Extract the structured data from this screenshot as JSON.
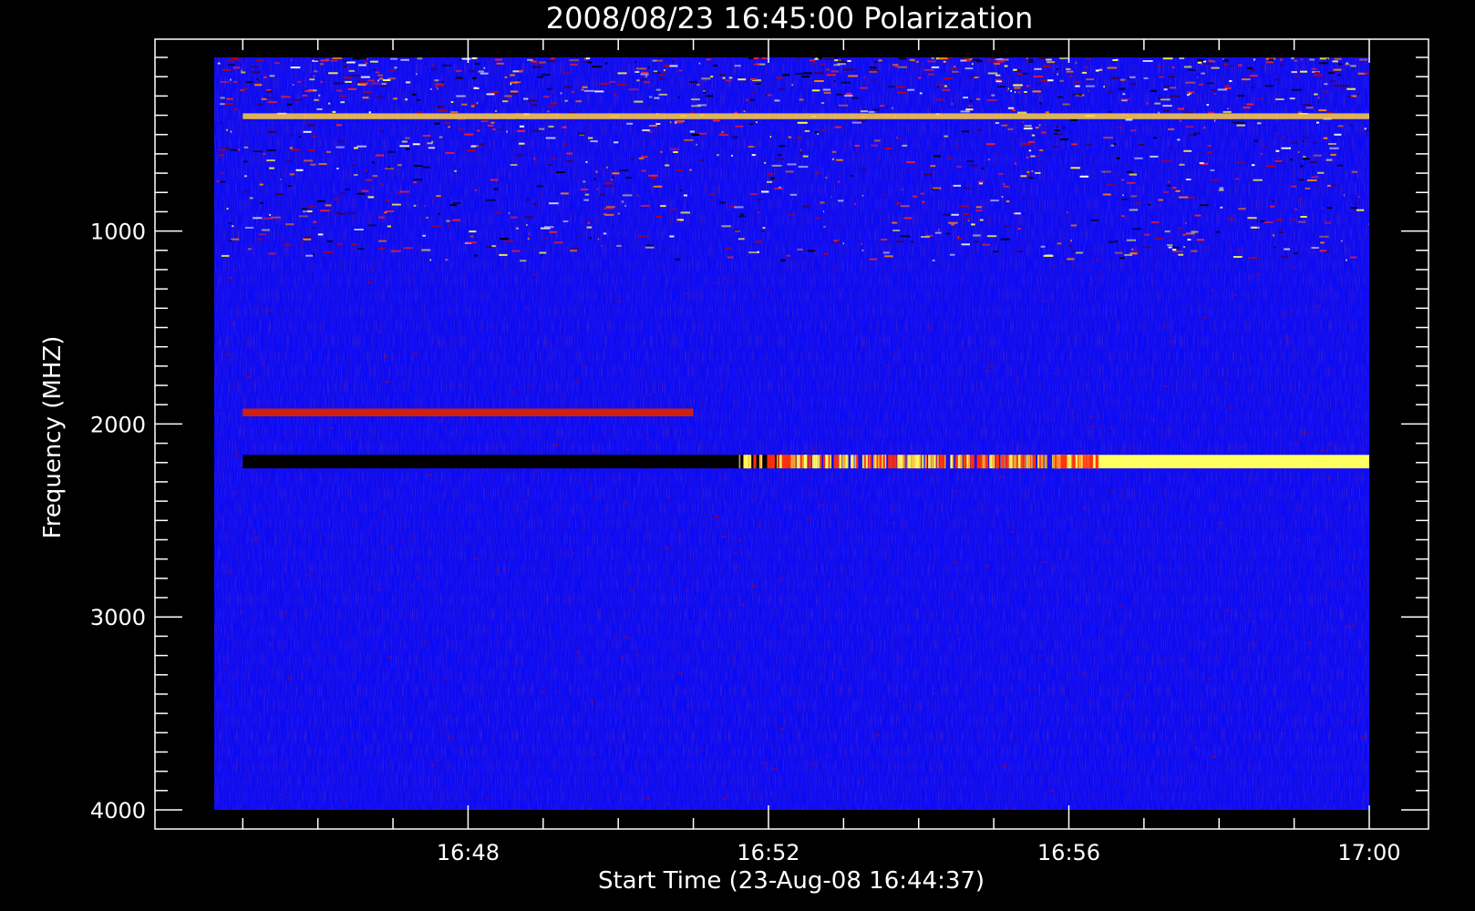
{
  "chart_data": {
    "type": "heatmap",
    "title": "2008/08/23 16:45:00 Polarization",
    "xlabel": "Start Time (23-Aug-08 16:44:37)",
    "ylabel": "Frequency (MHZ)",
    "x_tick_labels": [
      "16:48",
      "16:52",
      "16:56",
      "17:00"
    ],
    "x_tick_values_min_since_1644": [
      4,
      8,
      12,
      16
    ],
    "xlim_min_since_1644": [
      0.62,
      16
    ],
    "y_tick_labels": [
      "1000",
      "2000",
      "3000",
      "4000"
    ],
    "y_tick_values": [
      1000,
      2000,
      3000,
      4000
    ],
    "ylim": [
      4000,
      100
    ],
    "y_inverted": true,
    "grid": false,
    "colormap": [
      "#000000",
      "#0000ff",
      "#ff0000",
      "#ffff00",
      "#ffffff"
    ],
    "background_color": "#0a0af5",
    "features": [
      {
        "feature": "noisy band",
        "freq_range": [
          100,
          1150
        ],
        "time_range": [
          16.75,
          17.0
        ]
      },
      {
        "feature": "bright band",
        "freq_range": [
          390,
          420
        ],
        "time_range": [
          16.75,
          17.0
        ]
      },
      {
        "feature": "band",
        "freq_range": [
          1920,
          1960
        ],
        "time_range": [
          16.75,
          16.85
        ]
      },
      {
        "feature": "black band",
        "freq_range": [
          2160,
          2230
        ],
        "time_range": [
          16.75,
          16.87
        ]
      },
      {
        "feature": "yellow band",
        "freq_range": [
          2160,
          2230
        ],
        "time_range": [
          16.93,
          17.0
        ]
      }
    ]
  }
}
